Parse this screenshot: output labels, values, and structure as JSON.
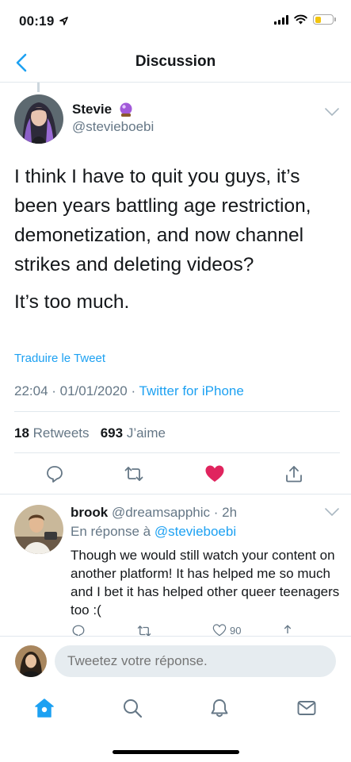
{
  "status_bar": {
    "time": "00:19",
    "battery_color": "#f2c40f"
  },
  "header": {
    "title": "Discussion",
    "back_icon": "chevron-left-icon"
  },
  "tweet": {
    "author_name": "Stevie",
    "author_emoji": "crystal-ball-icon",
    "author_handle": "@stevieboebi",
    "text_paragraphs": [
      "I think I have to quit you guys, it’s been years battling age restriction, demonetization, and now channel strikes and deleting videos?",
      "It’s too much."
    ],
    "translate_label": "Traduire le Tweet",
    "timestamp": "22:04 · 01/01/2020 · ",
    "client": "Twitter for iPhone",
    "retweets_count": "18",
    "retweets_label": "Retweets",
    "likes_count": "693",
    "likes_label": "J’aime",
    "liked": true,
    "like_color": "#e0245e"
  },
  "reply": {
    "author_name": "brook",
    "author_handle": "@dreamsapphic",
    "time": " · 2h",
    "reply_to_prefix": "En réponse à ",
    "reply_to_handle": "@stevieboebi",
    "text": "Though we would still watch your content on another platform! It has helped me so much and I bet it has helped other queer teenagers too :(",
    "likes_count": "90"
  },
  "compose": {
    "placeholder": "Tweetez votre réponse."
  },
  "tab_bar": {
    "items": [
      "home-icon",
      "search-icon",
      "notifications-icon",
      "messages-icon"
    ],
    "active": "home-icon"
  },
  "accent_color": "#1da1f2"
}
